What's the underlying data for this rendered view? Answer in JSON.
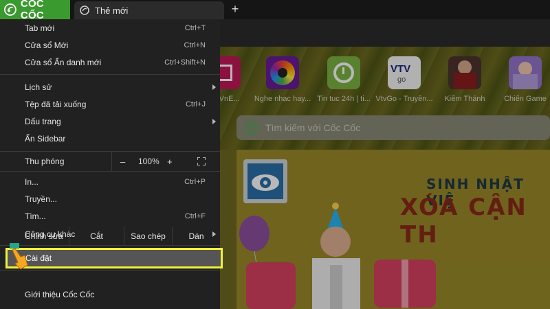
{
  "browser": {
    "brand": "CỐC CỐC",
    "tab_title": "Thẻ mới",
    "new_tab_symbol": "+"
  },
  "ntp": {
    "shortcuts": [
      {
        "label": "nh VnE...",
        "icon": "vnexpress-icon",
        "color": "#c2185b"
      },
      {
        "label": "Nghe nhạc hay...",
        "icon": "music-disc-icon",
        "color": "#7b1fa2"
      },
      {
        "label": "Tin tuc 24h | ti...",
        "icon": "refresh-clock-icon",
        "color": "#7cb342"
      },
      {
        "label": "VtvGo - Truyền...",
        "icon": "vtvgo-icon",
        "color": "#ffffff"
      },
      {
        "label": "Kiếm Thánh",
        "icon": "game-character-icon",
        "color": "#5d4037"
      },
      {
        "label": "Chiến Game",
        "icon": "game-avatar-icon",
        "color": "#9575cd"
      }
    ],
    "search_placeholder": "Tìm kiếm với Cốc Cốc",
    "banner": {
      "line1": "SINH NHẬT VIỆ",
      "line2": "XÓA CẬN TH"
    }
  },
  "menu": {
    "new_tab": {
      "label": "Tab mới",
      "shortcut": "Ctrl+T"
    },
    "new_window": {
      "label": "Cửa sổ Mới",
      "shortcut": "Ctrl+N"
    },
    "incognito": {
      "label": "Cửa sổ Ẩn danh mới",
      "shortcut": "Ctrl+Shift+N"
    },
    "history": {
      "label": "Lịch sử"
    },
    "downloads": {
      "label": "Tệp đã tải xuống",
      "shortcut": "Ctrl+J"
    },
    "bookmarks": {
      "label": "Dấu trang"
    },
    "hide_sidebar": {
      "label": "Ẩn Sidebar"
    },
    "zoom": {
      "label": "Thu phóng",
      "minus": "–",
      "value": "100%",
      "plus": "+"
    },
    "print": {
      "label": "In...",
      "shortcut": "Ctrl+P"
    },
    "cast": {
      "label": "Truyền..."
    },
    "find": {
      "label": "Tìm...",
      "shortcut": "Ctrl+F"
    },
    "more_tools": {
      "label": "Công cụ khác"
    },
    "edit": {
      "label": "Chỉnh sửa",
      "cut": "Cắt",
      "copy": "Sao chép",
      "paste": "Dán"
    },
    "settings": {
      "label": "Cài đặt"
    },
    "about": {
      "label": "Giới thiệu Cốc Cốc"
    }
  },
  "colors": {
    "brand_green": "#3b9a2f",
    "menu_bg": "#212121",
    "highlight_border": "#f2f23a"
  }
}
